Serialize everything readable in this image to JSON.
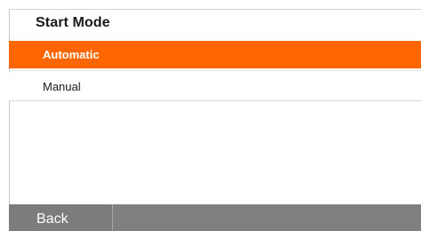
{
  "header": {
    "title": "Start Mode"
  },
  "options": [
    {
      "label": "Automatic",
      "selected": true
    },
    {
      "label": "Manual",
      "selected": false
    }
  ],
  "footer": {
    "back_label": "Back"
  },
  "colors": {
    "selected_bg": "#ff6600",
    "footer_bg": "#7c7c7c",
    "text": "#1a1a1a"
  }
}
